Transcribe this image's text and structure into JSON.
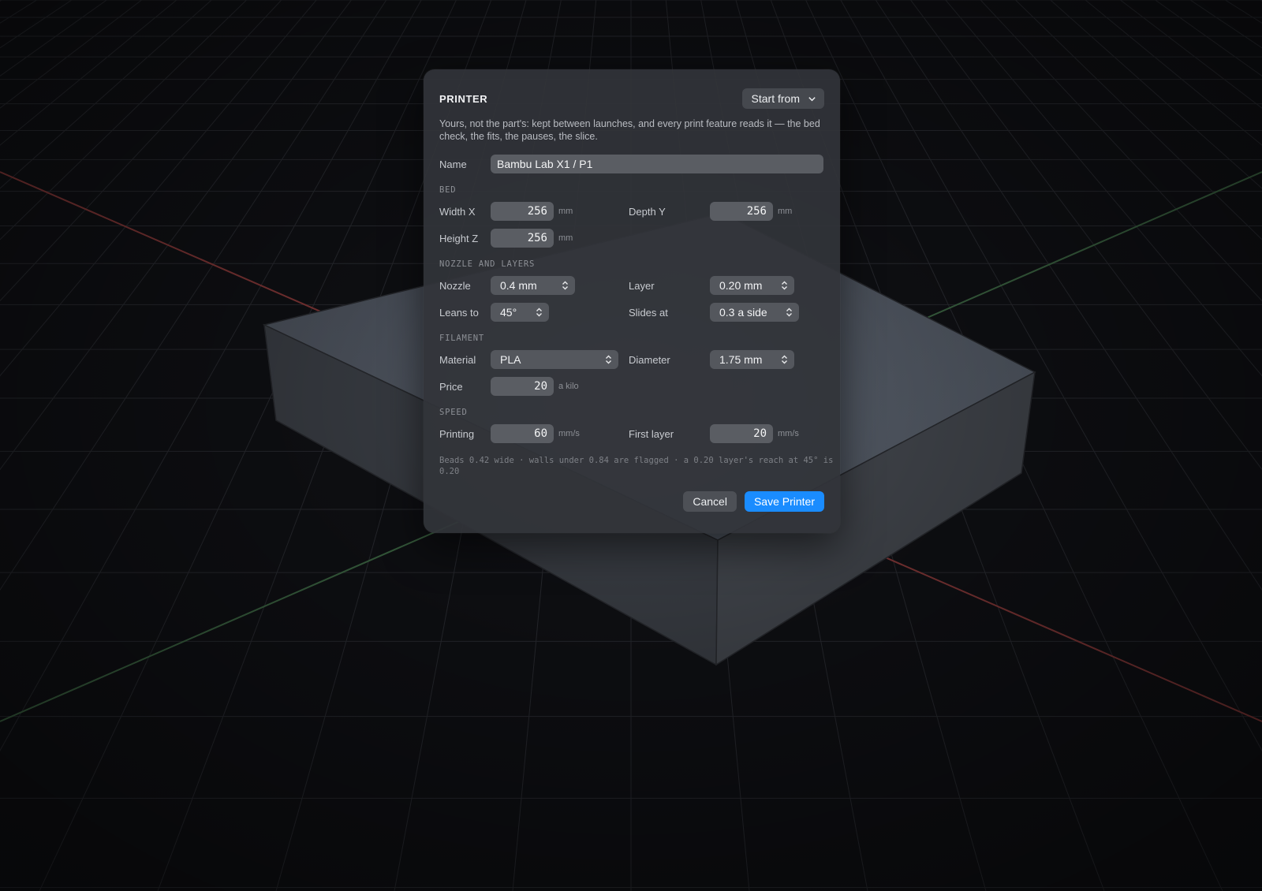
{
  "colors": {
    "accent": "#1a8cff",
    "x_axis": "#8a3a3a",
    "y_axis": "#3f6a46",
    "grid": "#2b2d33"
  },
  "panel": {
    "title": "PRINTER",
    "start_from": {
      "label": "Start from",
      "icon": "chevron-down-icon"
    },
    "description": "Yours, not the part's: kept between launches, and every print feature reads it — the bed check, the fits, the pauses, the slice.",
    "name": {
      "label": "Name",
      "value": "Bambu Lab X1 / P1"
    },
    "bed": {
      "heading": "BED",
      "width_x": {
        "label": "Width X",
        "value": "256",
        "unit": "mm"
      },
      "depth_y": {
        "label": "Depth Y",
        "value": "256",
        "unit": "mm"
      },
      "height_z": {
        "label": "Height Z",
        "value": "256",
        "unit": "mm"
      }
    },
    "nozzle_layers": {
      "heading": "NOZZLE AND LAYERS",
      "nozzle": {
        "label": "Nozzle",
        "value": "0.4 mm"
      },
      "layer": {
        "label": "Layer",
        "value": "0.20 mm"
      },
      "leans_to": {
        "label": "Leans to",
        "value": "45°"
      },
      "slides_at": {
        "label": "Slides at",
        "value": "0.3 a side"
      }
    },
    "filament": {
      "heading": "FILAMENT",
      "material": {
        "label": "Material",
        "value": "PLA"
      },
      "diameter": {
        "label": "Diameter",
        "value": "1.75 mm"
      },
      "price": {
        "label": "Price",
        "value": "20",
        "unit": "a kilo"
      }
    },
    "speed": {
      "heading": "SPEED",
      "printing": {
        "label": "Printing",
        "value": "60",
        "unit": "mm/s"
      },
      "first_layer": {
        "label": "First layer",
        "value": "20",
        "unit": "mm/s"
      }
    },
    "footnote": "Beads 0.42 wide · walls under 0.84 are flagged · a 0.20 layer's reach at 45° is 0.20",
    "cancel_label": "Cancel",
    "save_label": "Save Printer"
  }
}
